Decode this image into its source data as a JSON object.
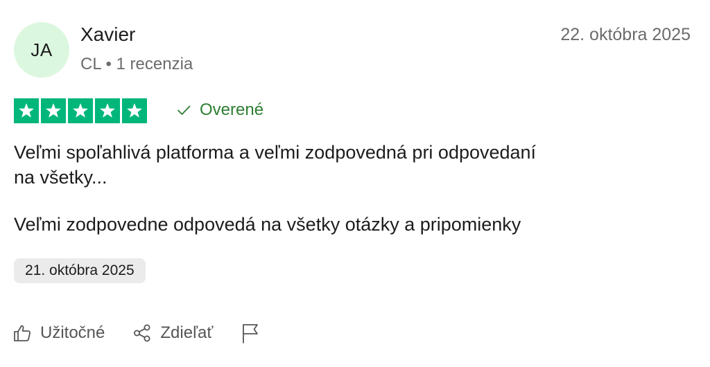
{
  "reviewer": {
    "initials": "JA",
    "name": "Xavier",
    "meta": "CL • 1 recenzia"
  },
  "review": {
    "date": "22. októbra 2025",
    "rating": 5,
    "verified_label": "Overené",
    "title_line1": "Veľmi spoľahlivá platforma a veľmi zodpovedná pri odpovedaní",
    "title_line2": "na všetky...",
    "body": "Veľmi zodpovedne odpovedá na všetky otázky a pripomienky",
    "experience_date": "21. októbra 2025"
  },
  "actions": {
    "useful_label": "Užitočné",
    "share_label": "Zdieľať"
  },
  "colors": {
    "star_bg": "#00b67a",
    "avatar_bg": "#dcf7df",
    "verified": "#2e7d32",
    "date_chip_bg": "#ebebeb"
  },
  "icons": [
    "check-icon",
    "star-icon",
    "thumbs-up-icon",
    "share-icon",
    "flag-icon"
  ]
}
